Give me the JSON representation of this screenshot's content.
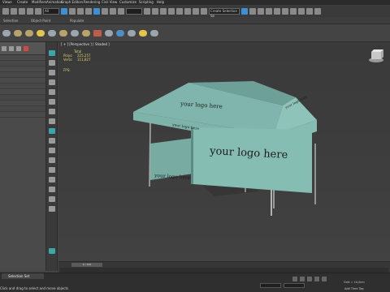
{
  "menu": [
    "Views",
    "Create",
    "Modifiers",
    "Animation",
    "Graph Editors",
    "Rendering",
    "Civil View",
    "Customize",
    "Scripting",
    "Help"
  ],
  "toolbar": {
    "selection_filter": "All",
    "view_dropdown": "Create Selection Se"
  },
  "ribbon": {
    "labels": [
      "Selection",
      "Object Paint",
      "Populate"
    ]
  },
  "viewport": {
    "label": "[ + ] [Perspective ] [ Shaded ]",
    "stats": {
      "header": "Total",
      "rows": [
        {
          "key": "Polys:",
          "value": "225,257"
        },
        {
          "key": "Verts:",
          "value": "111,827"
        }
      ],
      "fps": "FPS:"
    },
    "tent_text": [
      "your logo here",
      "your logo here",
      "your logo here",
      "your logo here",
      "your logo here"
    ],
    "colors": {
      "canopy": "#7fb5ac",
      "canopy_shade": "#6ea39a",
      "wall": "#86bdb3",
      "legs": "#a8aaaa",
      "text": "#1d1d1d"
    }
  },
  "timeline": {
    "frame": "0 / 100"
  },
  "status": {
    "selection_set": "Selection Set",
    "message": "Click and drag to select and move objects",
    "grid": "Grid = 10,0cm",
    "time_tag": "Add Time Tag"
  }
}
